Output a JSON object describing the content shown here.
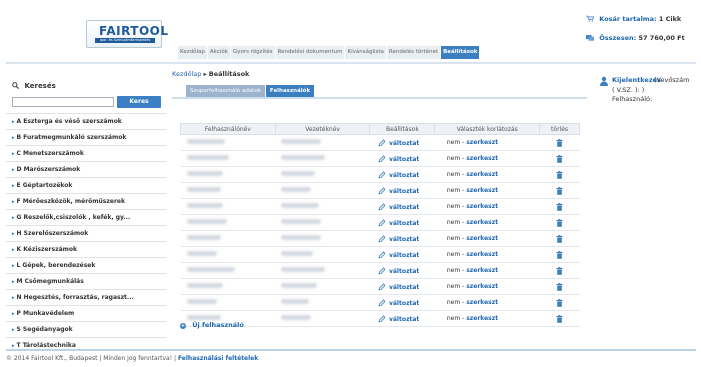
{
  "header": {
    "logo_text": "FAIRTOOL",
    "logo_sub": "Ipar- és Szerszámkereskedés",
    "nav": [
      "Kezdőlap",
      "Akciók",
      "Gyors rögzítés",
      "Rendelési dokumentum",
      "Kívánságlista",
      "Rendelés történet",
      "Beállítások"
    ],
    "cart_label": "Kosár tartalma:",
    "cart_value": "1 Cikk",
    "total_label": "Összesen:",
    "total_value": "57 760,00 Ft"
  },
  "sidebar": {
    "search_title": "Keresés",
    "search_value": "",
    "search_button": "Keres",
    "categories": [
      "A Esztergа és véső szerszámok",
      "B Furatmegmunkáló szerszámok",
      "C Menetszerszámok",
      "D Marószerszámok",
      "E Géptartozékok",
      "F Mérőeszközök, mérőműszerek",
      "G Reszelők,csiszolók , kefék, gy...",
      "H Szerelőszerszámok",
      "K Kéziszerszámok",
      "L Gépek, berendezések",
      "M Csőmegmunkálás",
      "N Hegesztés, forrasztás, ragaszt...",
      "P Munkavédelem",
      "S Segédanyagok",
      "T Tárolástechnika"
    ]
  },
  "main": {
    "breadcrumb_home": "Kezdőlap",
    "breadcrumb_sep": "▸",
    "breadcrumb_current": "Beállítások",
    "tabs": [
      "Szuperfelhasználó adatok",
      "Felhasználók"
    ],
    "columns": [
      "Felhasználónév",
      "Vezetéknév",
      "Beállítások",
      "Választék korlátozás",
      "törlés"
    ],
    "row_action": "változtat",
    "limit_text": "nem",
    "limit_sep": " - ",
    "limit_action": "szerkeszt",
    "new_user": "Új felhasználó"
  },
  "login": {
    "link": "Kijelentkezés",
    "first": "(Vevőszám",
    "line1": "( V.SZ. ):            )",
    "line2": "Felhasználó:"
  },
  "footer": {
    "text": "© 2014 Fairtool Kft., Budapest | Minden jog fenntartva! |",
    "link": "Felhasználási feltételek"
  },
  "colors": {
    "accent": "#3c7fc0",
    "link": "#1e66b0"
  }
}
